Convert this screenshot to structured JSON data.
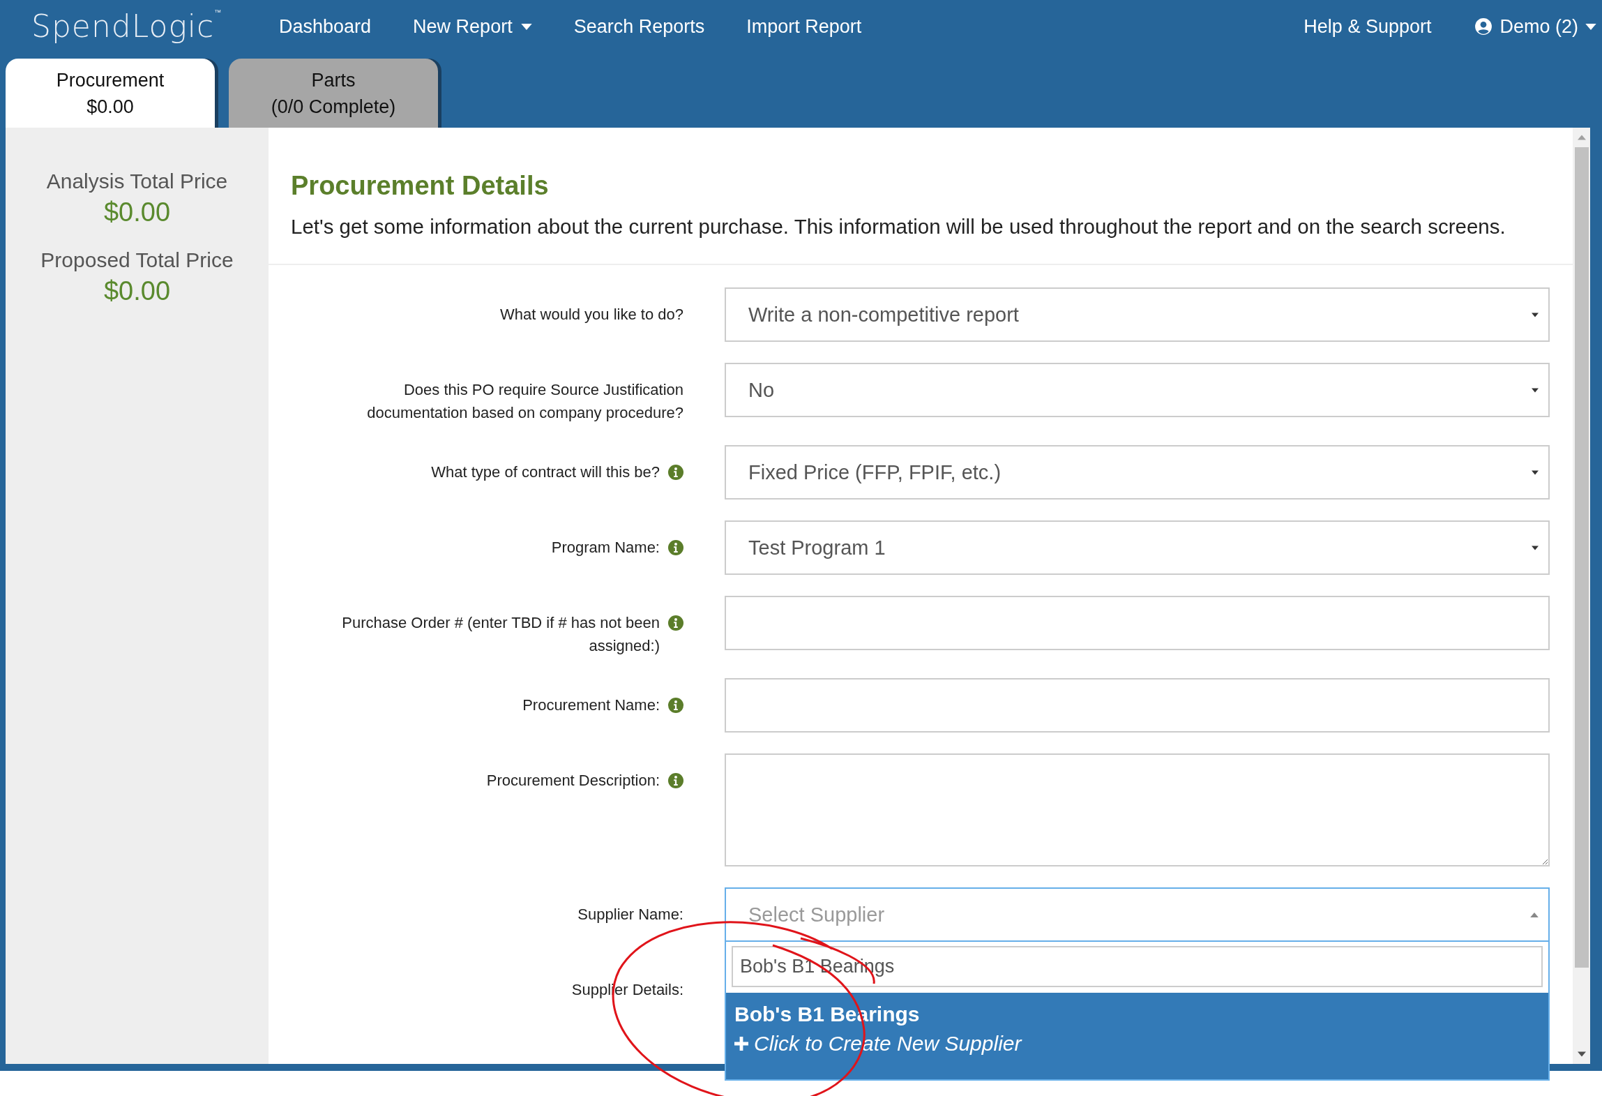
{
  "brand": {
    "name": "SpendLogic",
    "trademark": "™"
  },
  "nav": [
    {
      "label": "Dashboard",
      "dropdown": false
    },
    {
      "label": "New Report",
      "dropdown": true
    },
    {
      "label": "Search Reports",
      "dropdown": false
    },
    {
      "label": "Import Report",
      "dropdown": false
    }
  ],
  "nav_right": [
    {
      "label": "Help & Support",
      "kind": "link"
    },
    {
      "label": "Demo (2)",
      "kind": "user"
    }
  ],
  "tabs": [
    {
      "title": "Procurement",
      "subtitle": "$0.00",
      "selected": true
    },
    {
      "title": "Parts",
      "subtitle": "(0/0 Complete)",
      "selected": false
    }
  ],
  "totals": [
    {
      "label": "Analysis Total Price",
      "value": "$0.00"
    },
    {
      "label": "Proposed Total Price",
      "value": "$0.00"
    }
  ],
  "section": {
    "title": "Procurement Details",
    "description": "Let's get some information about the current purchase. This information will be used throughout the report and on the search screens."
  },
  "fields": [
    {
      "label": "What would you like to do?",
      "kind": "select",
      "value": "Write a non-competitive report",
      "info": false
    },
    {
      "label": "Does this PO require Source Justification documentation based on company procedure?",
      "kind": "select",
      "value": "No",
      "info": false
    },
    {
      "label": "What type of contract will this be?",
      "kind": "select",
      "value": "Fixed Price (FFP, FPIF, etc.)",
      "info": true
    },
    {
      "label": "Program Name:",
      "kind": "select",
      "value": "Test Program 1",
      "info": true
    },
    {
      "label": "Purchase Order # (enter TBD if # has not been assigned:)",
      "kind": "input",
      "info": true
    },
    {
      "label": "Procurement Name:",
      "kind": "input",
      "info": true
    },
    {
      "label": "Procurement Description:",
      "kind": "textarea",
      "info": true
    },
    {
      "label": "Supplier Name:",
      "kind": "combo",
      "placeholder": "Select Supplier",
      "info": false,
      "expanded": true,
      "search": "Bob's B1 Bearings",
      "results": [
        {
          "label": "Bob's B1 Bearings",
          "kind": "match"
        },
        {
          "label": "Click to Create New Supplier",
          "kind": "create"
        }
      ]
    },
    {
      "label": "Supplier Details:",
      "kind": "text",
      "info": false
    }
  ]
}
